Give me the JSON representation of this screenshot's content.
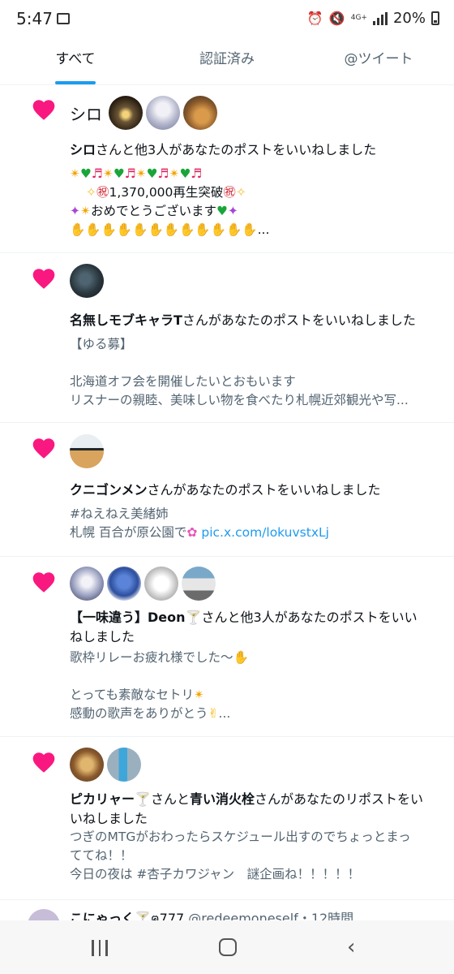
{
  "status_bar": {
    "time": "5:47",
    "network": "4G+",
    "battery": "20%"
  },
  "tabs": [
    "すべて",
    "認証済み",
    "@ツイート"
  ],
  "notifications": [
    {
      "user_label": "シロ",
      "message": {
        "bold": "シロ",
        "rest": "さんと他3人があなたのポストをいいねしました"
      },
      "post": {
        "line3": "1,370,000再生突破",
        "line4": "おめでとうございます",
        "ellipsis": "..."
      }
    },
    {
      "message": {
        "bold": "名無しモブキャラT",
        "rest": "さんがあなたのポストをいいねしました"
      },
      "post": {
        "line1": "【ゆる募】",
        "line2": "北海道オフ会を開催したいとおもいます",
        "line3": "リスナーの親睦、美味しい物を食べたり札幌近郊観光や写..."
      }
    },
    {
      "message": {
        "bold": "クニゴンメン",
        "rest": "さんがあなたのポストをいいねしました"
      },
      "post": {
        "line1": "#ねえねえ美緒姉",
        "line2_prefix": "札幌 百合が原公園で",
        "line2_link": "pic.x.com/lokuvstxLj"
      }
    },
    {
      "message": {
        "bold1": "【一味違う】Deon",
        "rest1": "さんと他3人があなたのポストをいい",
        "rest2": "ねしました"
      },
      "post": {
        "line1": "歌枠リレーお疲れ様でした〜",
        "line2": "とっても素敵なセトリ",
        "line3": "感動の歌声をありがとう",
        "ellipsis": "..."
      }
    },
    {
      "message": {
        "bold1": "ピカリャー",
        "mid": "さんと",
        "bold2": "青い消火栓",
        "rest1": "さんがあなたのリポストをい",
        "rest2": "いねしました"
      },
      "post": {
        "line1": "つぎのMTGがおわったらスケジュール出すのでちょっとまっ",
        "line2": "ててね！！",
        "line3": "今日の夜は #杏子カワジャン　謎企画ね！！！！！"
      }
    }
  ],
  "partial_item": {
    "name": "こにゃっく",
    "extra": "ฅ777",
    "handle": "@redeemoneself",
    "time": "・12時間"
  },
  "icons": [
    "gallery-icon",
    "alarm-icon",
    "mute-icon",
    "signal-icon",
    "battery-icon",
    "heart-icon",
    "recent-apps-icon",
    "home-icon",
    "back-icon"
  ],
  "colors": {
    "accent": "#1d9bf0",
    "heart": "#f91880",
    "text": "#0f1419",
    "secondary": "#536471"
  }
}
